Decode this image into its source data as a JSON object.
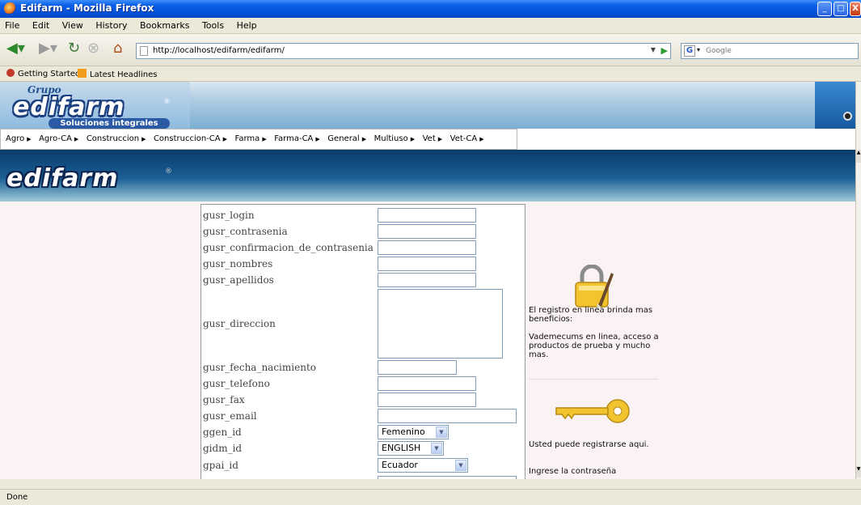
{
  "window": {
    "title": "Edifarm - Mozilla Firefox",
    "buttons": [
      "_",
      "□",
      "X"
    ]
  },
  "menu": [
    "File",
    "Edit",
    "View",
    "History",
    "Bookmarks",
    "Tools",
    "Help"
  ],
  "nav": {
    "url": "http://localhost/edifarm/edifarm/",
    "search_placeholder": "Google",
    "search_engine_icon": "G"
  },
  "bookmarks": [
    "Getting Started",
    "Latest Headlines"
  ],
  "header": {
    "grupo": "Grupo",
    "brand": "edifarm",
    "tagline": "Soluciones integrales",
    "registered": "®"
  },
  "categories": [
    "Agro",
    "Agro-CA",
    "Construccion",
    "Construccion-CA",
    "Farma",
    "Farma-CA",
    "General",
    "Multiuso",
    "Vet",
    "Vet-CA"
  ],
  "form": {
    "labels": {
      "login": "gusr_login",
      "contrasenia": "gusr_contrasenia",
      "confirmacion": "gusr_confirmacion_de_contrasenia",
      "nombres": "gusr_nombres",
      "apellidos": "gusr_apellidos",
      "direccion": "gusr_direccion",
      "fecha_nacimiento": "gusr_fecha_nacimiento",
      "telefono": "gusr_telefono",
      "fax": "gusr_fax",
      "email": "gusr_email",
      "gen": "ggen_id",
      "idm": "gidm_id",
      "pai": "gpai_id"
    },
    "selects": {
      "gen": "Femenino",
      "idm": "ENGLISH",
      "pai": "Ecuador"
    }
  },
  "side": {
    "benefit_title": "El registro en linea brinda mas beneficios:",
    "benefit_body": "Vademecums en linea, acceso a productos de prueba y mucho mas.",
    "register_text": "Usted puede registrarse aqui.",
    "password_text": "Ingrese la contraseña"
  },
  "status": "Done"
}
